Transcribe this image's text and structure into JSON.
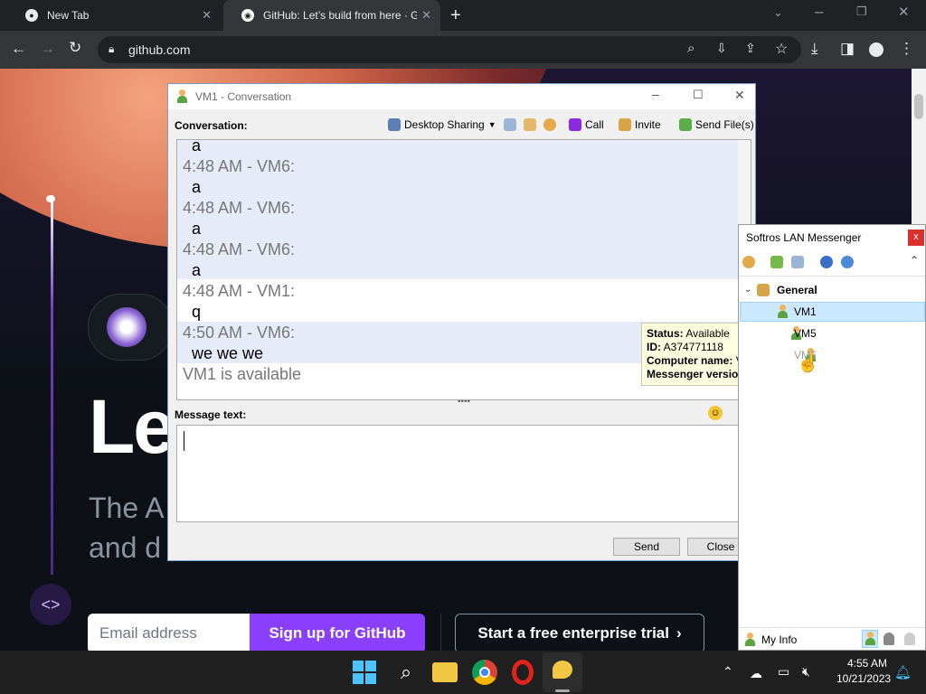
{
  "browser": {
    "tabs": [
      {
        "title": "New Tab"
      },
      {
        "title": "GitHub: Let’s build from here · Gi"
      }
    ],
    "url": "github.com"
  },
  "page": {
    "heading_fragment": "Le",
    "subtitle_line1": "The A",
    "subtitle_line2": "and d",
    "email_placeholder": "Email address",
    "signup_label": "Sign up for GitHub",
    "enterprise_label": "Start a free enterprise trial",
    "enterprise_chevron": "›"
  },
  "conversation": {
    "title": "VM1 - Conversation",
    "conversation_label": "Conversation:",
    "toolbar": {
      "desktop_sharing": "Desktop Sharing",
      "call": "Call",
      "invite": "Invite",
      "send_files": "Send File(s)"
    },
    "messages": [
      {
        "header": "",
        "text": "a"
      },
      {
        "header": "4:48 AM - VM6:",
        "text": "a"
      },
      {
        "header": "4:48 AM - VM6:",
        "text": "a"
      },
      {
        "header": "4:48 AM - VM6:",
        "text": "a"
      },
      {
        "header": "4:48 AM - VM1:",
        "text": "q"
      },
      {
        "header": "4:50 AM - VM6:",
        "text": "we we we"
      }
    ],
    "status_line": "VM1 is available",
    "message_text_label": "Message text:",
    "send_label": "Send",
    "close_label": "Close",
    "tooltip": {
      "status_key": "Status:",
      "status_value": "Available",
      "id_key": "ID:",
      "id_value": "A374771118",
      "computer_key": "Computer name:",
      "computer_value": "V",
      "version_key": "Messenger version"
    }
  },
  "messenger": {
    "title": "Softros LAN Messenger",
    "close_glyph": "x",
    "group": "General",
    "users": [
      "VM1",
      "VM5",
      "VM6"
    ],
    "my_info": "My Info"
  },
  "taskbar": {
    "time": "4:55 AM",
    "date": "10/21/2023"
  },
  "colors": {
    "chrome_dark": "#202124",
    "github_purple": "#8a3ffc",
    "selection": "#cce8ff"
  }
}
